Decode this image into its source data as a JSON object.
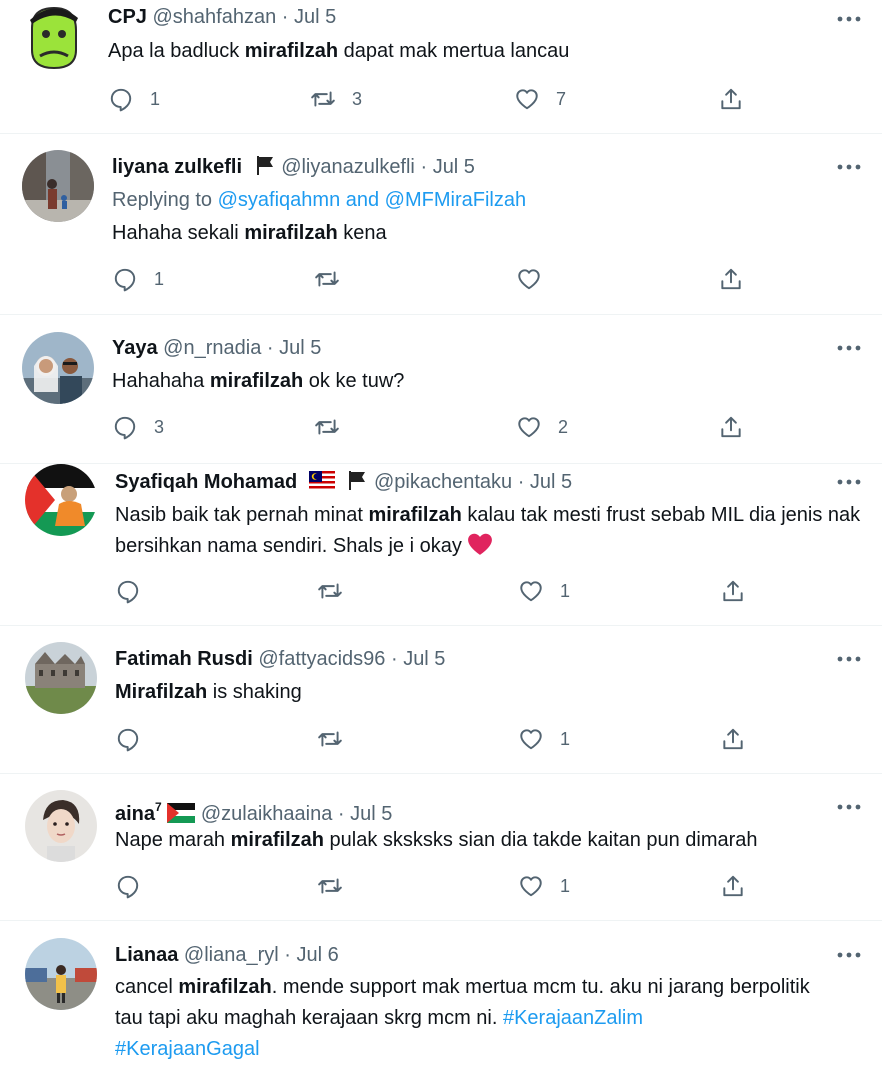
{
  "tweets": [
    {
      "name": "CPJ",
      "handle": "@shahfahzan",
      "date": "Jul 5",
      "text_before": "Apa la badluck ",
      "bold": "mirafilzah",
      "text_after": " dapat mak mertua lancau",
      "counts": {
        "reply": "1",
        "retweet": "3",
        "like": "7"
      },
      "avatar_icon": "green-cartoon-avatar"
    },
    {
      "name": "liyana zulkefli",
      "handle": "@liyanazulkefli",
      "date": "Jul 5",
      "replying_label": "Replying to ",
      "replying_to": "@syafiqahmn and @MFMiraFilzah",
      "text_before": "Hahaha sekali ",
      "bold": "mirafilzah",
      "text_after": " kena",
      "counts": {
        "reply": "1",
        "retweet": "",
        "like": ""
      },
      "avatar_icon": "street-photo-avatar"
    },
    {
      "name": "Yaya",
      "handle": "@n_rnadia",
      "date": "Jul 5",
      "text_before": "Hahahaha ",
      "bold": "mirafilzah",
      "text_after": " ok ke tuw?",
      "counts": {
        "reply": "3",
        "retweet": "",
        "like": "2"
      },
      "avatar_icon": "couple-selfie-avatar"
    },
    {
      "name": "Syafiqah Mohamad",
      "handle": "@pikachentaku",
      "date": "Jul 5",
      "text_before": "Nasib baik tak pernah minat ",
      "bold": "mirafilzah",
      "text_after": " kalau tak mesti frust sebab MIL dia jenis nak bersihkan nama sendiri. Shals je i okay ",
      "counts": {
        "reply": "",
        "retweet": "",
        "like": "1"
      },
      "avatar_icon": "palestine-flag-avatar"
    },
    {
      "name": "Fatimah Rusdi",
      "handle": "@fattyacids96",
      "date": "Jul 5",
      "bold": "Mirafilzah",
      "text_after": " is shaking",
      "counts": {
        "reply": "",
        "retweet": "",
        "like": "1"
      },
      "avatar_icon": "castle-photo-avatar"
    },
    {
      "name": "aina",
      "name_sup": "7",
      "handle": "@zulaikhaaina",
      "date": "Jul 5",
      "text_before": "Nape marah ",
      "bold": "mirafilzah",
      "text_after": " pulak sksksks sian dia takde kaitan pun dimarah",
      "counts": {
        "reply": "",
        "retweet": "",
        "like": "1"
      },
      "avatar_icon": "portrait-avatar"
    },
    {
      "name": "Lianaa",
      "handle": "@liana_ryl",
      "date": "Jul 6",
      "text_before": "cancel ",
      "bold": "mirafilzah",
      "text_after": ". mende support mak mertua mcm tu. aku ni jarang berpolitik tau tapi aku maghah kerajaan skrg mcm ni. ",
      "hashtag1": "#KerajaanZalim",
      "hashtag2": "#KerajaanGagal",
      "counts": {
        "reply": "",
        "retweet": "",
        "like": ""
      },
      "avatar_icon": "street-scene-avatar"
    }
  ],
  "colors": {
    "accent": "#1d9bf0",
    "muted": "#536471",
    "heart": "#e0245e"
  }
}
